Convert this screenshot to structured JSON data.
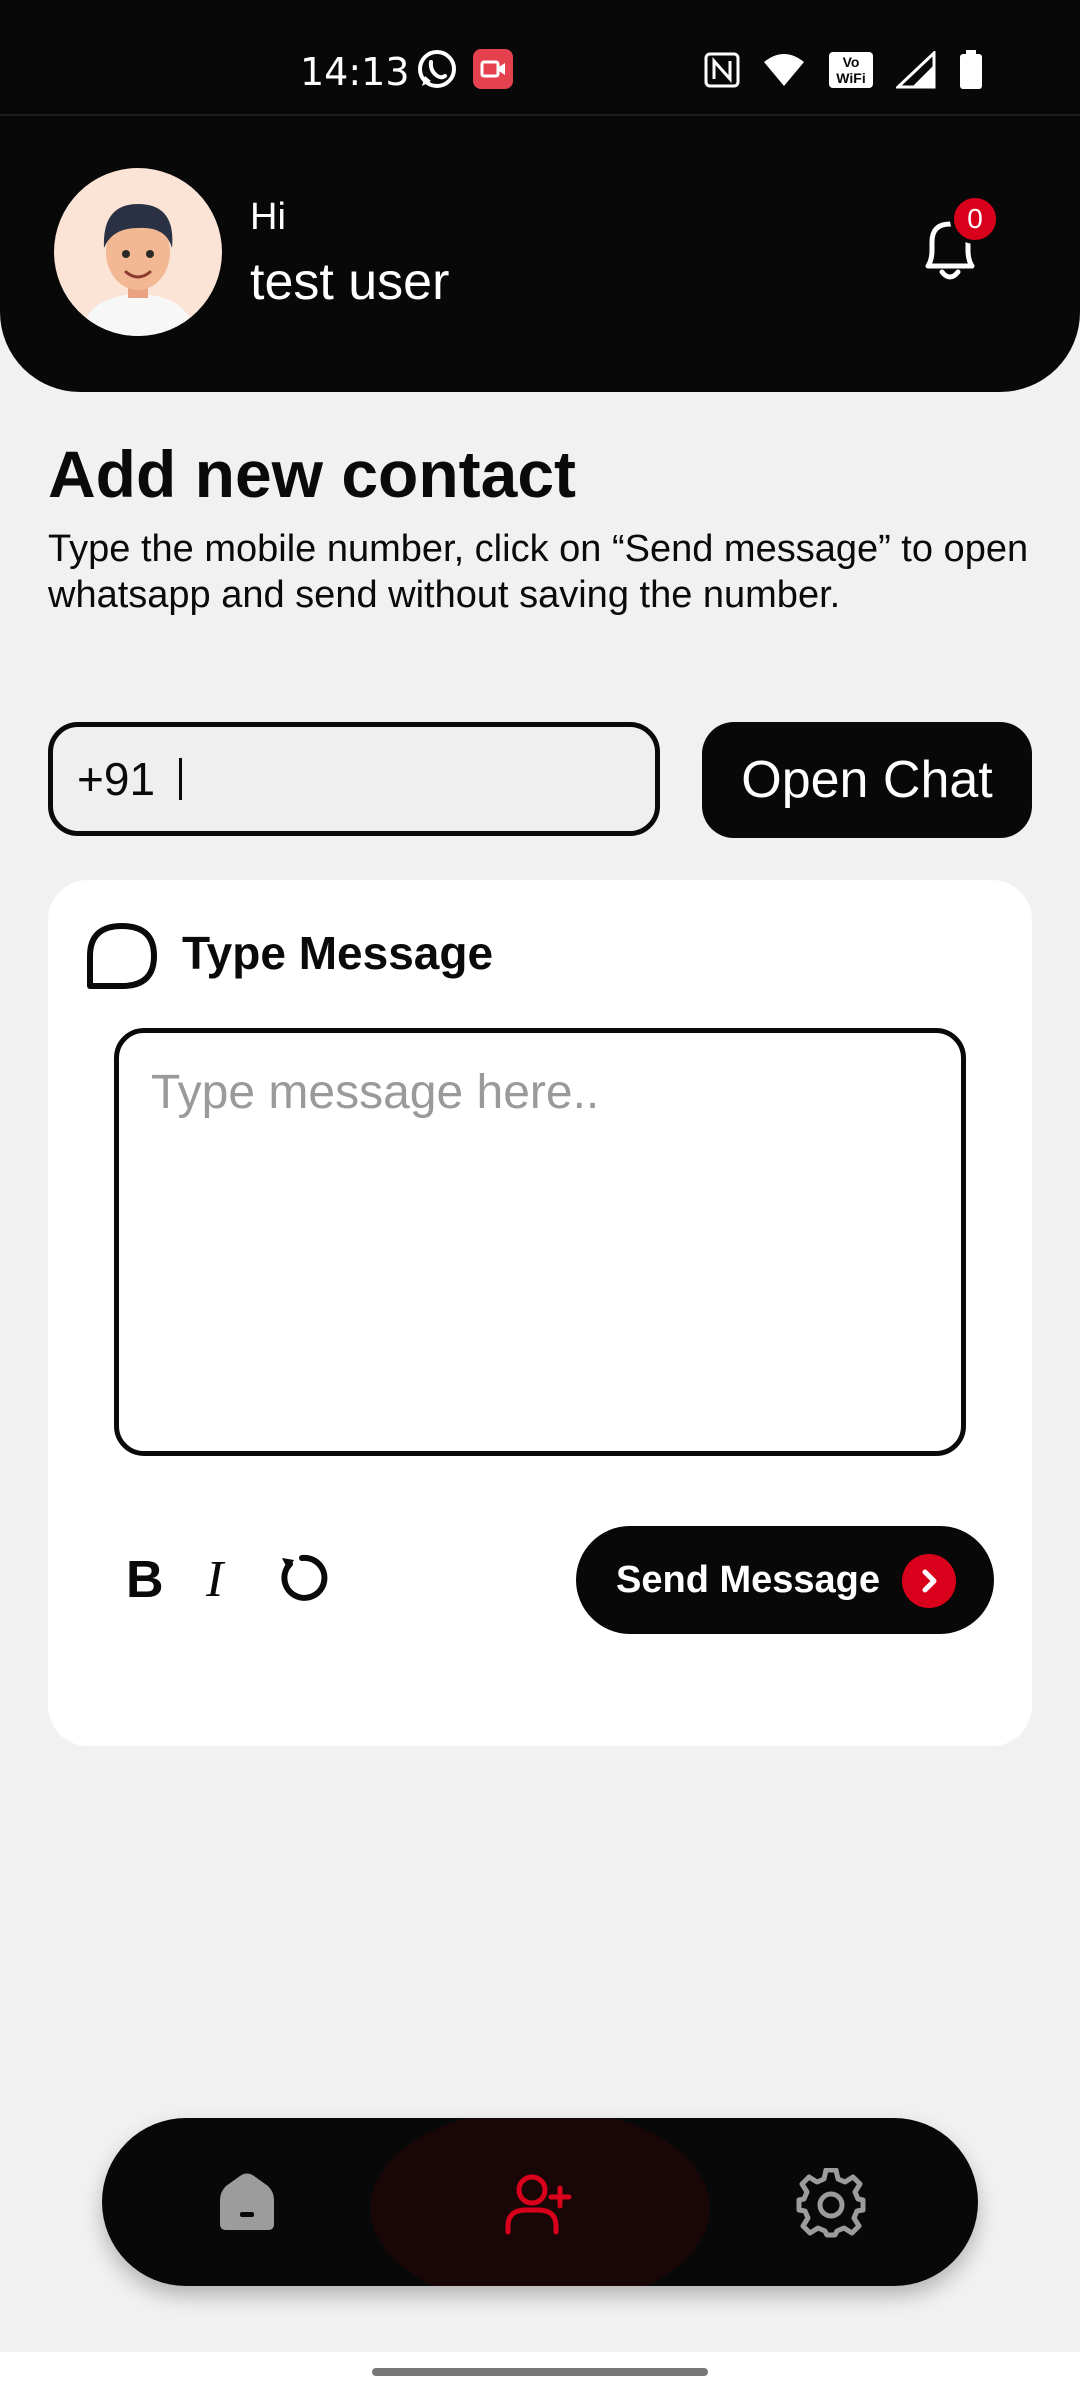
{
  "status_bar": {
    "time": "14:13",
    "left_icons": [
      "whatsapp-icon",
      "screen-record-icon"
    ],
    "right_icons": [
      "nfc-icon",
      "wifi-icon",
      "vowifi-icon",
      "signal-icon",
      "battery-icon"
    ],
    "vowifi_top": "Vo",
    "vowifi_bottom": "WiFi"
  },
  "header": {
    "greeting": "Hi",
    "username": "test user",
    "notification_count": "0",
    "avatar": "user-avatar"
  },
  "page": {
    "title": "Add new contact",
    "subtitle": "Type the mobile number, click on “Send message” to open whatsapp and send without saving the number."
  },
  "phone": {
    "country_code": "+91",
    "value": ""
  },
  "open_chat_label": "Open Chat",
  "message_card": {
    "title": "Type Message",
    "placeholder": "Type message here..",
    "bold_label": "B",
    "italic_label": "I",
    "send_label": "Send Message"
  },
  "bottom_nav": {
    "items": [
      "home-icon",
      "add-contact-icon",
      "settings-icon"
    ],
    "active": "add-contact-icon"
  },
  "colors": {
    "accent": "#d9001b",
    "dark": "#080808",
    "background": "#f1f1f1"
  }
}
